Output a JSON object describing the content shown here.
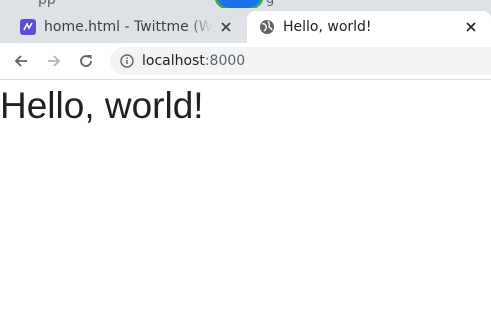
{
  "browser": {
    "tabs": [
      {
        "title": "home.html - Twittme (Wor",
        "active": false,
        "favicon": "app-icon"
      },
      {
        "title": "Hello, world!",
        "active": true,
        "favicon": "globe-icon"
      }
    ],
    "address_bar": {
      "host": "localhost",
      "port": ":8000",
      "security_icon": "info-icon"
    },
    "nav_icons": [
      "back-arrow-icon",
      "forward-arrow-icon",
      "reload-icon"
    ]
  },
  "page": {
    "heading": "Hello, world!"
  },
  "colors": {
    "tabstrip": "#dee1e6",
    "omnibox": "#f1f3f4",
    "app_favicon": "#5b4bd6",
    "text": "#202124"
  }
}
